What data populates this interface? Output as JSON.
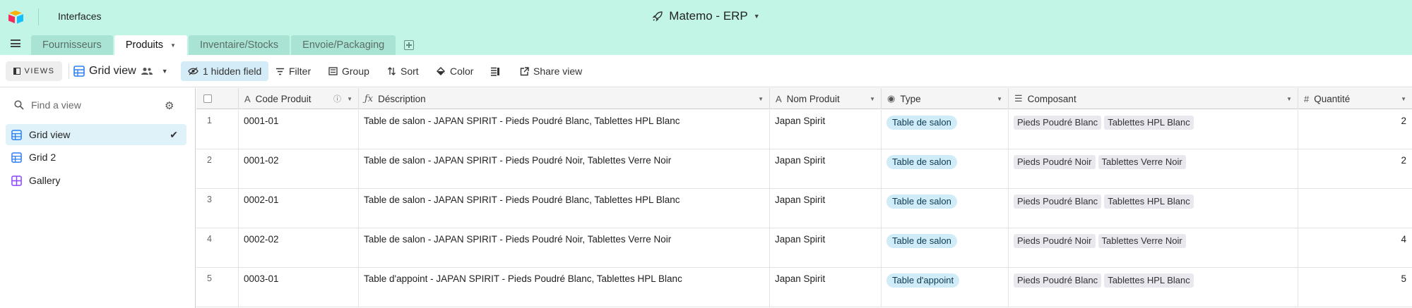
{
  "app": {
    "interfaces_label": "Interfaces",
    "base_title": "Matemo - ERP",
    "base_icon": "rocket-icon"
  },
  "tabs": [
    {
      "label": "Fournisseurs",
      "active": false
    },
    {
      "label": "Produits",
      "active": true
    },
    {
      "label": "Inventaire/Stocks",
      "active": false
    },
    {
      "label": "Envoie/Packaging",
      "active": false
    }
  ],
  "toolbar": {
    "views_label": "VIEWS",
    "current_view": "Grid view",
    "hidden_field": "1 hidden field",
    "filter": "Filter",
    "group": "Group",
    "sort": "Sort",
    "color": "Color",
    "share": "Share view"
  },
  "sidebar": {
    "search_placeholder": "Find a view",
    "views": [
      {
        "label": "Grid view",
        "icon": "grid-icon",
        "active": true
      },
      {
        "label": "Grid 2",
        "icon": "grid-icon",
        "active": false
      },
      {
        "label": "Gallery",
        "icon": "gallery-icon",
        "active": false
      }
    ]
  },
  "table": {
    "columns": [
      {
        "label": "Code Produit",
        "icon": "text-field-icon"
      },
      {
        "label": "Déscription",
        "icon": "formula-icon"
      },
      {
        "label": "Nom Produit",
        "icon": "text-field-icon"
      },
      {
        "label": "Type",
        "icon": "single-select-icon"
      },
      {
        "label": "Composant",
        "icon": "multi-select-icon"
      },
      {
        "label": "Quantité",
        "icon": "number-icon"
      }
    ],
    "rows": [
      {
        "num": "1",
        "code": "0001-01",
        "desc": "Table de salon - JAPAN SPIRIT - Pieds  Poudré  Blanc, Tablettes  HPL  Blanc",
        "nom": "Japan Spirit",
        "type": "Table de salon",
        "composant": [
          "Pieds Poudré Blanc",
          "Tablettes HPL Blanc"
        ],
        "qty": "2"
      },
      {
        "num": "2",
        "code": "0001-02",
        "desc": "Table de salon - JAPAN SPIRIT - Pieds  Poudré  Noir, Tablettes  Verre  Noir",
        "nom": "Japan Spirit",
        "type": "Table de salon",
        "composant": [
          "Pieds Poudré Noir",
          "Tablettes Verre Noir"
        ],
        "qty": "2"
      },
      {
        "num": "3",
        "code": "0002-01",
        "desc": "Table de salon - JAPAN SPIRIT - Pieds  Poudré  Blanc, Tablettes  HPL  Blanc",
        "nom": "Japan Spirit",
        "type": "Table de salon",
        "composant": [
          "Pieds Poudré Blanc",
          "Tablettes HPL Blanc"
        ],
        "qty": ""
      },
      {
        "num": "4",
        "code": "0002-02",
        "desc": "Table de salon - JAPAN SPIRIT - Pieds  Poudré  Noir, Tablettes  Verre  Noir",
        "nom": "Japan Spirit",
        "type": "Table de salon",
        "composant": [
          "Pieds Poudré Noir",
          "Tablettes Verre Noir"
        ],
        "qty": "4"
      },
      {
        "num": "5",
        "code": "0003-01",
        "desc": "Table d'appoint - JAPAN SPIRIT - Pieds  Poudré  Blanc, Tablettes  HPL  Blanc",
        "nom": "Japan Spirit",
        "type": "Table d'appoint",
        "composant": [
          "Pieds Poudré Blanc",
          "Tablettes HPL Blanc"
        ],
        "qty": "5"
      }
    ]
  },
  "colors": {
    "header_bg": "#c2f5e6",
    "accent": "#2d7ff9",
    "type_pill": "#d0ecf8"
  }
}
